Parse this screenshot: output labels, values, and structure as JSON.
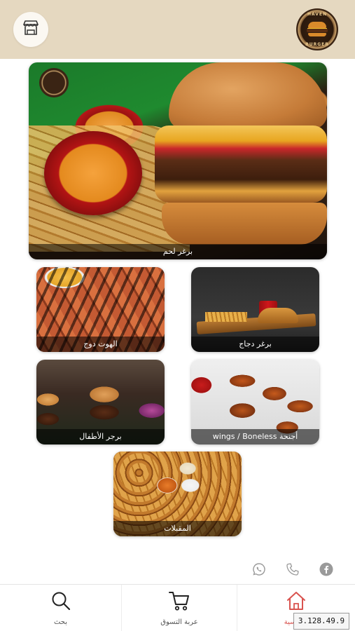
{
  "header": {
    "logo": {
      "text_top": "HAVEN",
      "text_bottom": "BURGER"
    },
    "store_icon": "store-icon"
  },
  "categories": {
    "hero": {
      "label": "برغر لحم"
    },
    "hotdog": {
      "label": "الهوت دوج"
    },
    "chicken_burger": {
      "label": "برغر دجاج"
    },
    "kids_burger": {
      "label": "برجر الأطفال"
    },
    "wings": {
      "label": "أجنحة wings / Boneless"
    },
    "appetizers": {
      "label": "المقبلات"
    }
  },
  "social": {
    "facebook": "facebook-icon",
    "phone": "phone-icon",
    "whatsapp": "whatsapp-icon"
  },
  "bottom_nav": {
    "search_label": "بحث",
    "cart_label": "عربة التسوق",
    "home_label": "الرئيسية"
  },
  "version": "3.128.49.9",
  "colors": {
    "header_bg": "#e5d8c0",
    "home_active": "#d9534f",
    "icon_gray": "#9a9a9a"
  }
}
